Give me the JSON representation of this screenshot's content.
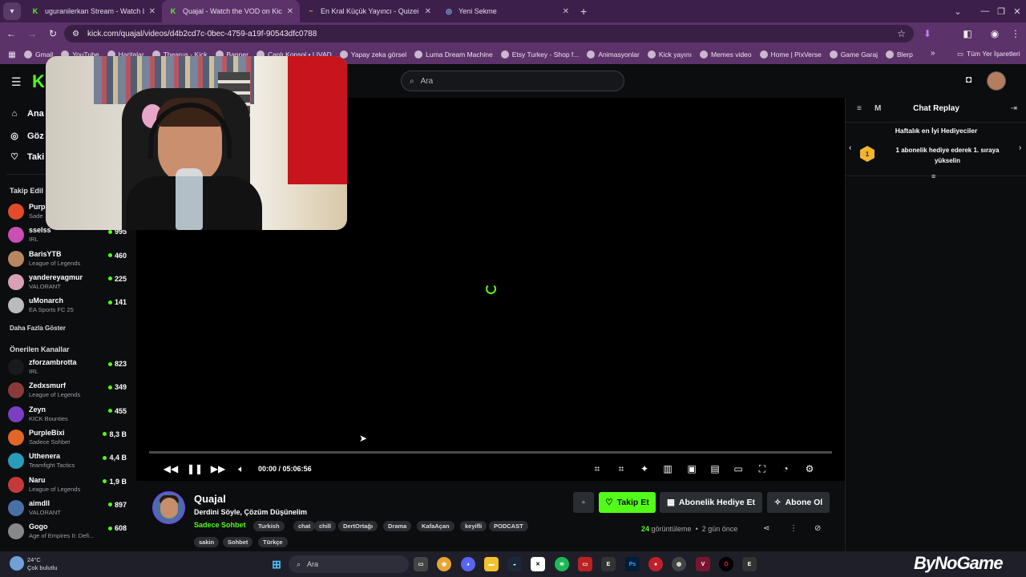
{
  "browser": {
    "tabs": [
      {
        "label": "uguranilerkan Stream - Watch L",
        "favicon": "K",
        "color": "#53fc18",
        "active": false
      },
      {
        "label": "Quajal - Watch the VOD on Kick",
        "favicon": "K",
        "color": "#53fc18",
        "active": true
      },
      {
        "label": "En Kral Küçük Yayıncı - Quizei",
        "favicon": "~",
        "color": "#e0a030",
        "active": false
      },
      {
        "label": "Yeni Sekme",
        "favicon": "◎",
        "color": "#8ab4f8",
        "active": false
      }
    ],
    "url": "kick.com/quajal/videos/d4b2cd7c-0bec-4759-a19f-90543dfc0788",
    "bookmarks": [
      "Gmail",
      "YouTube",
      "Haritalar",
      "Thearus - Kick",
      "Banner",
      "Canlı Konsol • LIVAD",
      "Yapay zeka görsel",
      "Luma Dream Machine",
      "Etsy Turkey - Shop f...",
      "Animasyonlar",
      "Kick yayını",
      "Memes video",
      "Home | PixVerse",
      "Game Garaj",
      "Blerp"
    ],
    "bookmarks_overflow": "»",
    "all_bookmarks": "Tüm Yer İşaretleri"
  },
  "nav": {
    "search_placeholder": "Ara",
    "menu": [
      "Ana",
      "Göz",
      "Taki"
    ]
  },
  "sidebar": {
    "followed_header": "Takip Edil",
    "followed": [
      {
        "name": "Purp",
        "category": "Sade",
        "viewers": "",
        "color": "#e24a2a"
      },
      {
        "name": "sselss",
        "category": "IRL",
        "viewers": "995",
        "color": "#c94fb4"
      },
      {
        "name": "BarisYTB",
        "category": "League of Legends",
        "viewers": "460",
        "color": "#b8875f"
      },
      {
        "name": "yandereyagmur",
        "category": "VALORANT",
        "viewers": "225",
        "color": "#d9a0b8"
      },
      {
        "name": "uMonarch",
        "category": "EA Sports FC 25",
        "viewers": "141",
        "color": "#bbbbbb"
      }
    ],
    "show_more": "Daha Fazla Göster",
    "recommended_header": "Önerilen Kanallar",
    "recommended": [
      {
        "name": "zforzambrotta",
        "category": "IRL",
        "viewers": "823",
        "color": "#1a1a1a"
      },
      {
        "name": "Zedxsmurf",
        "category": "League of Legends",
        "viewers": "349",
        "color": "#8a3a3a"
      },
      {
        "name": "Zeyn",
        "category": "KICK Bounties",
        "viewers": "455",
        "color": "#7b3fc4"
      },
      {
        "name": "PurpleBixi",
        "category": "Sadece Sohbet",
        "viewers": "8,3 B",
        "color": "#e2652a"
      },
      {
        "name": "Uthenera",
        "category": "Teamfight Tactics",
        "viewers": "4,4 B",
        "color": "#2a9bb8"
      },
      {
        "name": "Naru",
        "category": "League of Legends",
        "viewers": "1,9 B",
        "color": "#c43a3a"
      },
      {
        "name": "aimdll",
        "category": "VALORANT",
        "viewers": "897",
        "color": "#4a6fa5"
      },
      {
        "name": "Gogo",
        "category": "Age of Empires II: Defi...",
        "viewers": "608",
        "color": "#888888"
      }
    ]
  },
  "player": {
    "progress": 0.0,
    "time_current": "00:00",
    "time_total": "05:06:56"
  },
  "chat": {
    "mode_label": "M",
    "title": "Chat Replay",
    "gifters_header": "Haftalık en İyi Hediyeciler",
    "rank": "1",
    "gift_message": "1 abonelik hediye ederek 1. sıraya yükselin"
  },
  "stream": {
    "name": "Quajal",
    "title": "Derdini Söyle, Çözüm Düşünelim",
    "category": "Sadece Sohbet",
    "tags": [
      "Turkish",
      "chat",
      "chill",
      "DertOrtağı",
      "Drama",
      "KafaAçan",
      "keyifli",
      "PODCAST",
      "sakin",
      "Sohbet",
      "Türkçe"
    ],
    "follow_label": "Takip Et",
    "gift_sub_label": "Abonelik Hediye Et",
    "subscribe_label": "Abone Ol",
    "views": "24",
    "views_label": "görüntüleme",
    "age": "2 gün önce"
  },
  "taskbar": {
    "temp": "24°C",
    "weather": "Çok bulutlu",
    "search": "Ara",
    "watermark": "ByNoGame"
  }
}
